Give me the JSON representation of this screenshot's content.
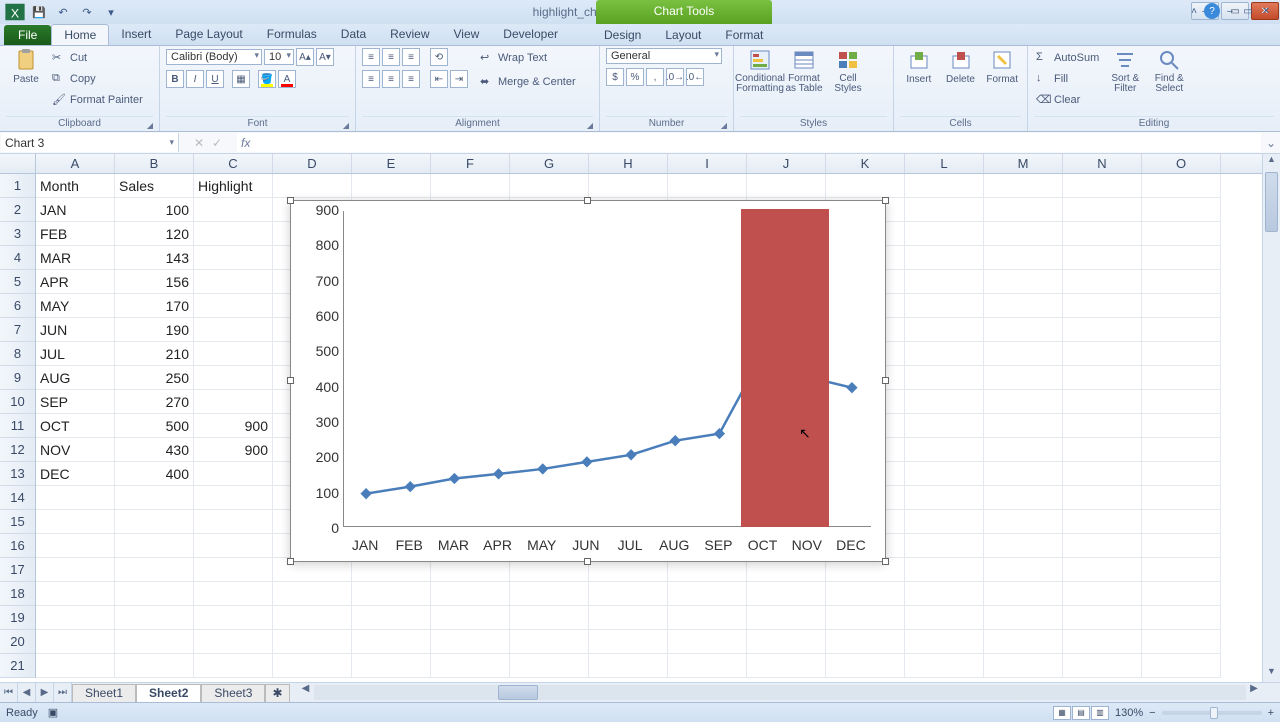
{
  "title": "highlight_chart_section - Microsoft Excel",
  "chart_tools_label": "Chart Tools",
  "window_controls": {
    "minimize": "–",
    "maximize": "▭",
    "close": "✕"
  },
  "tabs": {
    "file": "File",
    "list": [
      "Home",
      "Insert",
      "Page Layout",
      "Formulas",
      "Data",
      "Review",
      "View",
      "Developer"
    ],
    "chart_tools": [
      "Design",
      "Layout",
      "Format"
    ],
    "active": "Home"
  },
  "ribbon": {
    "clipboard": {
      "label": "Clipboard",
      "paste": "Paste",
      "cut": "Cut",
      "copy": "Copy  ",
      "format_painter": "Format Painter"
    },
    "font": {
      "label": "Font",
      "name": "Calibri (Body)",
      "size": "10"
    },
    "alignment": {
      "label": "Alignment",
      "wrap": "Wrap Text",
      "merge": "Merge & Center"
    },
    "number": {
      "label": "Number",
      "format": "General"
    },
    "styles": {
      "label": "Styles",
      "cond": "Conditional\nFormatting",
      "table": "Format\nas Table",
      "cell": "Cell\nStyles"
    },
    "cells": {
      "label": "Cells",
      "insert": "Insert",
      "delete": "Delete",
      "format": "Format"
    },
    "editing": {
      "label": "Editing",
      "autosum": "AutoSum",
      "fill": "Fill",
      "clear": "Clear",
      "sort": "Sort &\nFilter",
      "find": "Find &\nSelect"
    }
  },
  "name_box": "Chart 3",
  "formula_bar": "",
  "columns": [
    "A",
    "B",
    "C",
    "D",
    "E",
    "F",
    "G",
    "H",
    "I",
    "J",
    "K",
    "L",
    "M",
    "N",
    "O"
  ],
  "rows_visible": 21,
  "table": {
    "headers": {
      "A": "Month",
      "B": "Sales",
      "C": "Highlight"
    },
    "rows": [
      {
        "A": "JAN",
        "B": 100,
        "C": ""
      },
      {
        "A": "FEB",
        "B": 120,
        "C": ""
      },
      {
        "A": "MAR",
        "B": 143,
        "C": ""
      },
      {
        "A": "APR",
        "B": 156,
        "C": ""
      },
      {
        "A": "MAY",
        "B": 170,
        "C": ""
      },
      {
        "A": "JUN",
        "B": 190,
        "C": ""
      },
      {
        "A": "JUL",
        "B": 210,
        "C": ""
      },
      {
        "A": "AUG",
        "B": 250,
        "C": ""
      },
      {
        "A": "SEP",
        "B": 270,
        "C": ""
      },
      {
        "A": "OCT",
        "B": 500,
        "C": 900
      },
      {
        "A": "NOV",
        "B": 430,
        "C": 900
      },
      {
        "A": "DEC",
        "B": 400,
        "C": ""
      }
    ]
  },
  "chart_data": {
    "type": "line",
    "categories": [
      "JAN",
      "FEB",
      "MAR",
      "APR",
      "MAY",
      "JUN",
      "JUL",
      "AUG",
      "SEP",
      "OCT",
      "NOV",
      "DEC"
    ],
    "series": [
      {
        "name": "Sales",
        "type": "line",
        "values": [
          100,
          120,
          143,
          156,
          170,
          190,
          210,
          250,
          270,
          500,
          430,
          400
        ],
        "color": "#4a7ebb"
      },
      {
        "name": "Highlight",
        "type": "bar",
        "values": [
          null,
          null,
          null,
          null,
          null,
          null,
          null,
          null,
          null,
          900,
          900,
          null
        ],
        "color": "#c0504d"
      }
    ],
    "y_ticks": [
      0,
      100,
      200,
      300,
      400,
      500,
      600,
      700,
      800,
      900
    ],
    "ylim": [
      0,
      900
    ]
  },
  "sheet_tabs": {
    "list": [
      "Sheet1",
      "Sheet2",
      "Sheet3"
    ],
    "active": "Sheet2"
  },
  "status": {
    "left": "Ready",
    "zoom": "130%"
  }
}
